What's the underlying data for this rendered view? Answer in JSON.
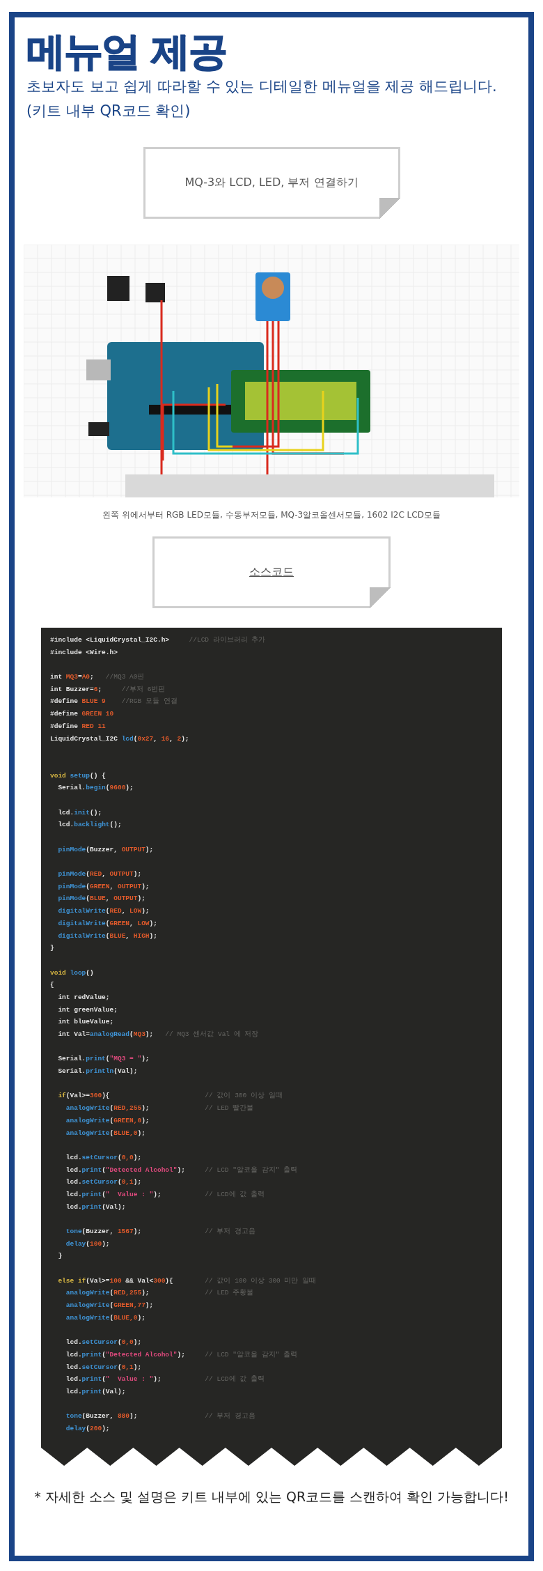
{
  "heading": {
    "title": "메뉴얼 제공",
    "subtitle_lines": [
      "초보자도 보고 쉽게 따라할 수 있는 디테일한 메뉴얼을 제공 해드립니다.",
      "(키트 내부 QR코드 확인)"
    ]
  },
  "note_1": {
    "text": "MQ-3와 LCD, LED, 부저  연결하기",
    "underlined": false
  },
  "diagram": {
    "kind": "picture",
    "caption": "왼쪽 위에서부터 RGB LED모듈, 수동부저모듈, MQ-3알코올센서모듈, 1602 I2C LCD모듈"
  },
  "note_2": {
    "text": "소스코드",
    "underlined": true
  },
  "code": {
    "lines": [
      {
        "kind": "code",
        "tokens": [
          {
            "kind": "plain",
            "text": "#include <LiquidCrystal_I2C.h>"
          },
          {
            "kind": "cmt",
            "text": "     //LCD 라이브러리 추가"
          }
        ]
      },
      {
        "kind": "code",
        "tokens": [
          {
            "kind": "plain",
            "text": "#include <Wire.h>"
          }
        ]
      },
      {
        "kind": "blank"
      },
      {
        "kind": "code",
        "tokens": [
          {
            "kind": "plain",
            "text": "int "
          },
          {
            "kind": "const",
            "text": "MQ3"
          },
          {
            "kind": "plain",
            "text": "="
          },
          {
            "kind": "const",
            "text": "A0"
          },
          {
            "kind": "plain",
            "text": ";"
          },
          {
            "kind": "cmt",
            "text": "   //MQ3 A0핀"
          }
        ]
      },
      {
        "kind": "code",
        "tokens": [
          {
            "kind": "plain",
            "text": "int Buzzer="
          },
          {
            "kind": "const",
            "text": "6"
          },
          {
            "kind": "plain",
            "text": ";"
          },
          {
            "kind": "cmt",
            "text": "     //부저 6번핀"
          }
        ]
      },
      {
        "kind": "code",
        "tokens": [
          {
            "kind": "plain",
            "text": "#define "
          },
          {
            "kind": "const",
            "text": "BLUE 9"
          },
          {
            "kind": "cmt",
            "text": "    //RGB 모듈 연결"
          }
        ]
      },
      {
        "kind": "code",
        "tokens": [
          {
            "kind": "plain",
            "text": "#define "
          },
          {
            "kind": "const",
            "text": "GREEN 10"
          }
        ]
      },
      {
        "kind": "code",
        "tokens": [
          {
            "kind": "plain",
            "text": "#define "
          },
          {
            "kind": "const",
            "text": "RED 11"
          }
        ]
      },
      {
        "kind": "code",
        "tokens": [
          {
            "kind": "plain",
            "text": "LiquidCrystal_I2C "
          },
          {
            "kind": "fn",
            "text": "lcd"
          },
          {
            "kind": "plain",
            "text": "("
          },
          {
            "kind": "const",
            "text": "0x27"
          },
          {
            "kind": "plain",
            "text": ", "
          },
          {
            "kind": "const",
            "text": "16"
          },
          {
            "kind": "plain",
            "text": ", "
          },
          {
            "kind": "const",
            "text": "2"
          },
          {
            "kind": "plain",
            "text": ");"
          }
        ]
      },
      {
        "kind": "blank"
      },
      {
        "kind": "blank"
      },
      {
        "kind": "code",
        "tokens": [
          {
            "kind": "kw",
            "text": "void "
          },
          {
            "kind": "fn",
            "text": "setup"
          },
          {
            "kind": "plain",
            "text": "() {"
          }
        ]
      },
      {
        "kind": "code",
        "tokens": [
          {
            "kind": "plain",
            "text": "  Serial."
          },
          {
            "kind": "fn",
            "text": "begin"
          },
          {
            "kind": "plain",
            "text": "("
          },
          {
            "kind": "const",
            "text": "9600"
          },
          {
            "kind": "plain",
            "text": ");"
          }
        ]
      },
      {
        "kind": "blank"
      },
      {
        "kind": "code",
        "tokens": [
          {
            "kind": "plain",
            "text": "  lcd."
          },
          {
            "kind": "fn",
            "text": "init"
          },
          {
            "kind": "plain",
            "text": "();"
          }
        ]
      },
      {
        "kind": "code",
        "tokens": [
          {
            "kind": "plain",
            "text": "  lcd."
          },
          {
            "kind": "fn",
            "text": "backlight"
          },
          {
            "kind": "plain",
            "text": "();"
          }
        ]
      },
      {
        "kind": "blank"
      },
      {
        "kind": "code",
        "tokens": [
          {
            "kind": "fn",
            "text": "  pinMode"
          },
          {
            "kind": "plain",
            "text": "(Buzzer, "
          },
          {
            "kind": "const",
            "text": "OUTPUT"
          },
          {
            "kind": "plain",
            "text": ");"
          }
        ]
      },
      {
        "kind": "blank"
      },
      {
        "kind": "code",
        "tokens": [
          {
            "kind": "fn",
            "text": "  pinMode"
          },
          {
            "kind": "plain",
            "text": "("
          },
          {
            "kind": "const",
            "text": "RED"
          },
          {
            "kind": "plain",
            "text": ", "
          },
          {
            "kind": "const",
            "text": "OUTPUT"
          },
          {
            "kind": "plain",
            "text": ");"
          }
        ]
      },
      {
        "kind": "code",
        "tokens": [
          {
            "kind": "fn",
            "text": "  pinMode"
          },
          {
            "kind": "plain",
            "text": "("
          },
          {
            "kind": "const",
            "text": "GREEN"
          },
          {
            "kind": "plain",
            "text": ", "
          },
          {
            "kind": "const",
            "text": "OUTPUT"
          },
          {
            "kind": "plain",
            "text": ");"
          }
        ]
      },
      {
        "kind": "code",
        "tokens": [
          {
            "kind": "fn",
            "text": "  pinMode"
          },
          {
            "kind": "plain",
            "text": "("
          },
          {
            "kind": "const",
            "text": "BLUE"
          },
          {
            "kind": "plain",
            "text": ", "
          },
          {
            "kind": "const",
            "text": "OUTPUT"
          },
          {
            "kind": "plain",
            "text": ");"
          }
        ]
      },
      {
        "kind": "code",
        "tokens": [
          {
            "kind": "fn",
            "text": "  digitalWrite"
          },
          {
            "kind": "plain",
            "text": "("
          },
          {
            "kind": "const",
            "text": "RED"
          },
          {
            "kind": "plain",
            "text": ", "
          },
          {
            "kind": "const",
            "text": "LOW"
          },
          {
            "kind": "plain",
            "text": ");"
          }
        ]
      },
      {
        "kind": "code",
        "tokens": [
          {
            "kind": "fn",
            "text": "  digitalWrite"
          },
          {
            "kind": "plain",
            "text": "("
          },
          {
            "kind": "const",
            "text": "GREEN"
          },
          {
            "kind": "plain",
            "text": ", "
          },
          {
            "kind": "const",
            "text": "LOW"
          },
          {
            "kind": "plain",
            "text": ");"
          }
        ]
      },
      {
        "kind": "code",
        "tokens": [
          {
            "kind": "fn",
            "text": "  digitalWrite"
          },
          {
            "kind": "plain",
            "text": "("
          },
          {
            "kind": "const",
            "text": "BLUE"
          },
          {
            "kind": "plain",
            "text": ", "
          },
          {
            "kind": "const",
            "text": "HIGH"
          },
          {
            "kind": "plain",
            "text": ");"
          }
        ]
      },
      {
        "kind": "code",
        "tokens": [
          {
            "kind": "plain",
            "text": "}"
          }
        ]
      },
      {
        "kind": "blank"
      },
      {
        "kind": "code",
        "tokens": [
          {
            "kind": "kw",
            "text": "void "
          },
          {
            "kind": "fn",
            "text": "loop"
          },
          {
            "kind": "plain",
            "text": "()"
          }
        ]
      },
      {
        "kind": "code",
        "tokens": [
          {
            "kind": "plain",
            "text": "{"
          }
        ]
      },
      {
        "kind": "code",
        "tokens": [
          {
            "kind": "plain",
            "text": "  int redValue;"
          }
        ]
      },
      {
        "kind": "code",
        "tokens": [
          {
            "kind": "plain",
            "text": "  int greenValue;"
          }
        ]
      },
      {
        "kind": "code",
        "tokens": [
          {
            "kind": "plain",
            "text": "  int blueValue;"
          }
        ]
      },
      {
        "kind": "code",
        "tokens": [
          {
            "kind": "plain",
            "text": "  int Val="
          },
          {
            "kind": "fn",
            "text": "analogRead"
          },
          {
            "kind": "plain",
            "text": "("
          },
          {
            "kind": "const",
            "text": "MQ3"
          },
          {
            "kind": "plain",
            "text": ");"
          },
          {
            "kind": "cmt",
            "text": "   // MQ3 센서값 Val 에 저장"
          }
        ]
      },
      {
        "kind": "blank"
      },
      {
        "kind": "code",
        "tokens": [
          {
            "kind": "plain",
            "text": "  Serial."
          },
          {
            "kind": "fn",
            "text": "print"
          },
          {
            "kind": "plain",
            "text": "("
          },
          {
            "kind": "str",
            "text": "\"MQ3 = \""
          },
          {
            "kind": "plain",
            "text": ");"
          }
        ]
      },
      {
        "kind": "code",
        "tokens": [
          {
            "kind": "plain",
            "text": "  Serial."
          },
          {
            "kind": "fn",
            "text": "println"
          },
          {
            "kind": "plain",
            "text": "(Val);"
          }
        ]
      },
      {
        "kind": "blank"
      },
      {
        "kind": "code",
        "tokens": [
          {
            "kind": "kw",
            "text": "  if"
          },
          {
            "kind": "plain",
            "text": "(Val>="
          },
          {
            "kind": "const",
            "text": "300"
          },
          {
            "kind": "plain",
            "text": "){"
          },
          {
            "kind": "cmt",
            "text": "                        // 값이 300 이상 일때"
          }
        ]
      },
      {
        "kind": "code",
        "tokens": [
          {
            "kind": "fn",
            "text": "    analogWrite"
          },
          {
            "kind": "plain",
            "text": "("
          },
          {
            "kind": "const",
            "text": "RED,255"
          },
          {
            "kind": "plain",
            "text": ");"
          },
          {
            "kind": "cmt",
            "text": "              // LED 빨간불"
          }
        ]
      },
      {
        "kind": "code",
        "tokens": [
          {
            "kind": "fn",
            "text": "    analogWrite"
          },
          {
            "kind": "plain",
            "text": "("
          },
          {
            "kind": "const",
            "text": "GREEN,0"
          },
          {
            "kind": "plain",
            "text": ");"
          }
        ]
      },
      {
        "kind": "code",
        "tokens": [
          {
            "kind": "fn",
            "text": "    analogWrite"
          },
          {
            "kind": "plain",
            "text": "("
          },
          {
            "kind": "const",
            "text": "BLUE,0"
          },
          {
            "kind": "plain",
            "text": ");"
          }
        ]
      },
      {
        "kind": "blank"
      },
      {
        "kind": "code",
        "tokens": [
          {
            "kind": "plain",
            "text": "    lcd."
          },
          {
            "kind": "fn",
            "text": "setCursor"
          },
          {
            "kind": "plain",
            "text": "("
          },
          {
            "kind": "const",
            "text": "0,0"
          },
          {
            "kind": "plain",
            "text": ");"
          }
        ]
      },
      {
        "kind": "code",
        "tokens": [
          {
            "kind": "plain",
            "text": "    lcd."
          },
          {
            "kind": "fn",
            "text": "print"
          },
          {
            "kind": "plain",
            "text": "("
          },
          {
            "kind": "str",
            "text": "\"Detected Alcohol\""
          },
          {
            "kind": "plain",
            "text": ");"
          },
          {
            "kind": "cmt",
            "text": "     // LCD \"알코올 감지\" 출력"
          }
        ]
      },
      {
        "kind": "code",
        "tokens": [
          {
            "kind": "plain",
            "text": "    lcd."
          },
          {
            "kind": "fn",
            "text": "setCursor"
          },
          {
            "kind": "plain",
            "text": "("
          },
          {
            "kind": "const",
            "text": "0,1"
          },
          {
            "kind": "plain",
            "text": ");"
          }
        ]
      },
      {
        "kind": "code",
        "tokens": [
          {
            "kind": "plain",
            "text": "    lcd."
          },
          {
            "kind": "fn",
            "text": "print"
          },
          {
            "kind": "plain",
            "text": "("
          },
          {
            "kind": "str",
            "text": "\"  Value : \""
          },
          {
            "kind": "plain",
            "text": ");"
          },
          {
            "kind": "cmt",
            "text": "           // LCD에 값 출력"
          }
        ]
      },
      {
        "kind": "code",
        "tokens": [
          {
            "kind": "plain",
            "text": "    lcd."
          },
          {
            "kind": "fn",
            "text": "print"
          },
          {
            "kind": "plain",
            "text": "(Val);"
          }
        ]
      },
      {
        "kind": "blank"
      },
      {
        "kind": "code",
        "tokens": [
          {
            "kind": "fn",
            "text": "    tone"
          },
          {
            "kind": "plain",
            "text": "(Buzzer, "
          },
          {
            "kind": "const",
            "text": "1567"
          },
          {
            "kind": "plain",
            "text": ");"
          },
          {
            "kind": "cmt",
            "text": "                // 부저 경고음"
          }
        ]
      },
      {
        "kind": "code",
        "tokens": [
          {
            "kind": "fn",
            "text": "    delay"
          },
          {
            "kind": "plain",
            "text": "("
          },
          {
            "kind": "const",
            "text": "100"
          },
          {
            "kind": "plain",
            "text": ");"
          }
        ]
      },
      {
        "kind": "code",
        "tokens": [
          {
            "kind": "plain",
            "text": "  }"
          }
        ]
      },
      {
        "kind": "blank"
      },
      {
        "kind": "code",
        "tokens": [
          {
            "kind": "kw",
            "text": "  else if"
          },
          {
            "kind": "plain",
            "text": "(Val>="
          },
          {
            "kind": "const",
            "text": "100"
          },
          {
            "kind": "plain",
            "text": " && Val<"
          },
          {
            "kind": "const",
            "text": "300"
          },
          {
            "kind": "plain",
            "text": "){"
          },
          {
            "kind": "cmt",
            "text": "        // 값이 100 이상 300 미만 일때"
          }
        ]
      },
      {
        "kind": "code",
        "tokens": [
          {
            "kind": "fn",
            "text": "    analogWrite"
          },
          {
            "kind": "plain",
            "text": "("
          },
          {
            "kind": "const",
            "text": "RED,255"
          },
          {
            "kind": "plain",
            "text": ");"
          },
          {
            "kind": "cmt",
            "text": "              // LED 주황불"
          }
        ]
      },
      {
        "kind": "code",
        "tokens": [
          {
            "kind": "fn",
            "text": "    analogWrite"
          },
          {
            "kind": "plain",
            "text": "("
          },
          {
            "kind": "const",
            "text": "GREEN,77"
          },
          {
            "kind": "plain",
            "text": ");"
          }
        ]
      },
      {
        "kind": "code",
        "tokens": [
          {
            "kind": "fn",
            "text": "    analogWrite"
          },
          {
            "kind": "plain",
            "text": "("
          },
          {
            "kind": "const",
            "text": "BLUE,0"
          },
          {
            "kind": "plain",
            "text": ");"
          }
        ]
      },
      {
        "kind": "blank"
      },
      {
        "kind": "code",
        "tokens": [
          {
            "kind": "plain",
            "text": "    lcd."
          },
          {
            "kind": "fn",
            "text": "setCursor"
          },
          {
            "kind": "plain",
            "text": "("
          },
          {
            "kind": "const",
            "text": "0,0"
          },
          {
            "kind": "plain",
            "text": ");"
          }
        ]
      },
      {
        "kind": "code",
        "tokens": [
          {
            "kind": "plain",
            "text": "    lcd."
          },
          {
            "kind": "fn",
            "text": "print"
          },
          {
            "kind": "plain",
            "text": "("
          },
          {
            "kind": "str",
            "text": "\"Detected Alcohol\""
          },
          {
            "kind": "plain",
            "text": ");"
          },
          {
            "kind": "cmt",
            "text": "     // LCD \"알코올 감지\" 출력"
          }
        ]
      },
      {
        "kind": "code",
        "tokens": [
          {
            "kind": "plain",
            "text": "    lcd."
          },
          {
            "kind": "fn",
            "text": "setCursor"
          },
          {
            "kind": "plain",
            "text": "("
          },
          {
            "kind": "const",
            "text": "0,1"
          },
          {
            "kind": "plain",
            "text": ");"
          }
        ]
      },
      {
        "kind": "code",
        "tokens": [
          {
            "kind": "plain",
            "text": "    lcd."
          },
          {
            "kind": "fn",
            "text": "print"
          },
          {
            "kind": "plain",
            "text": "("
          },
          {
            "kind": "str",
            "text": "\"  Value : \""
          },
          {
            "kind": "plain",
            "text": ");"
          },
          {
            "kind": "cmt",
            "text": "           // LCD에 값 출력"
          }
        ]
      },
      {
        "kind": "code",
        "tokens": [
          {
            "kind": "plain",
            "text": "    lcd."
          },
          {
            "kind": "fn",
            "text": "print"
          },
          {
            "kind": "plain",
            "text": "(Val);"
          }
        ]
      },
      {
        "kind": "blank"
      },
      {
        "kind": "code",
        "tokens": [
          {
            "kind": "fn",
            "text": "    tone"
          },
          {
            "kind": "plain",
            "text": "(Buzzer, "
          },
          {
            "kind": "const",
            "text": "880"
          },
          {
            "kind": "plain",
            "text": ");"
          },
          {
            "kind": "cmt",
            "text": "                 // 부저 경고음"
          }
        ]
      },
      {
        "kind": "code",
        "tokens": [
          {
            "kind": "fn",
            "text": "    delay"
          },
          {
            "kind": "plain",
            "text": "("
          },
          {
            "kind": "const",
            "text": "200"
          },
          {
            "kind": "plain",
            "text": ");"
          }
        ]
      }
    ]
  },
  "footer": "*  자세한 소스 및 설명은 키트 내부에 있는 QR코드를 스캔하여 확인 가능합니다!"
}
